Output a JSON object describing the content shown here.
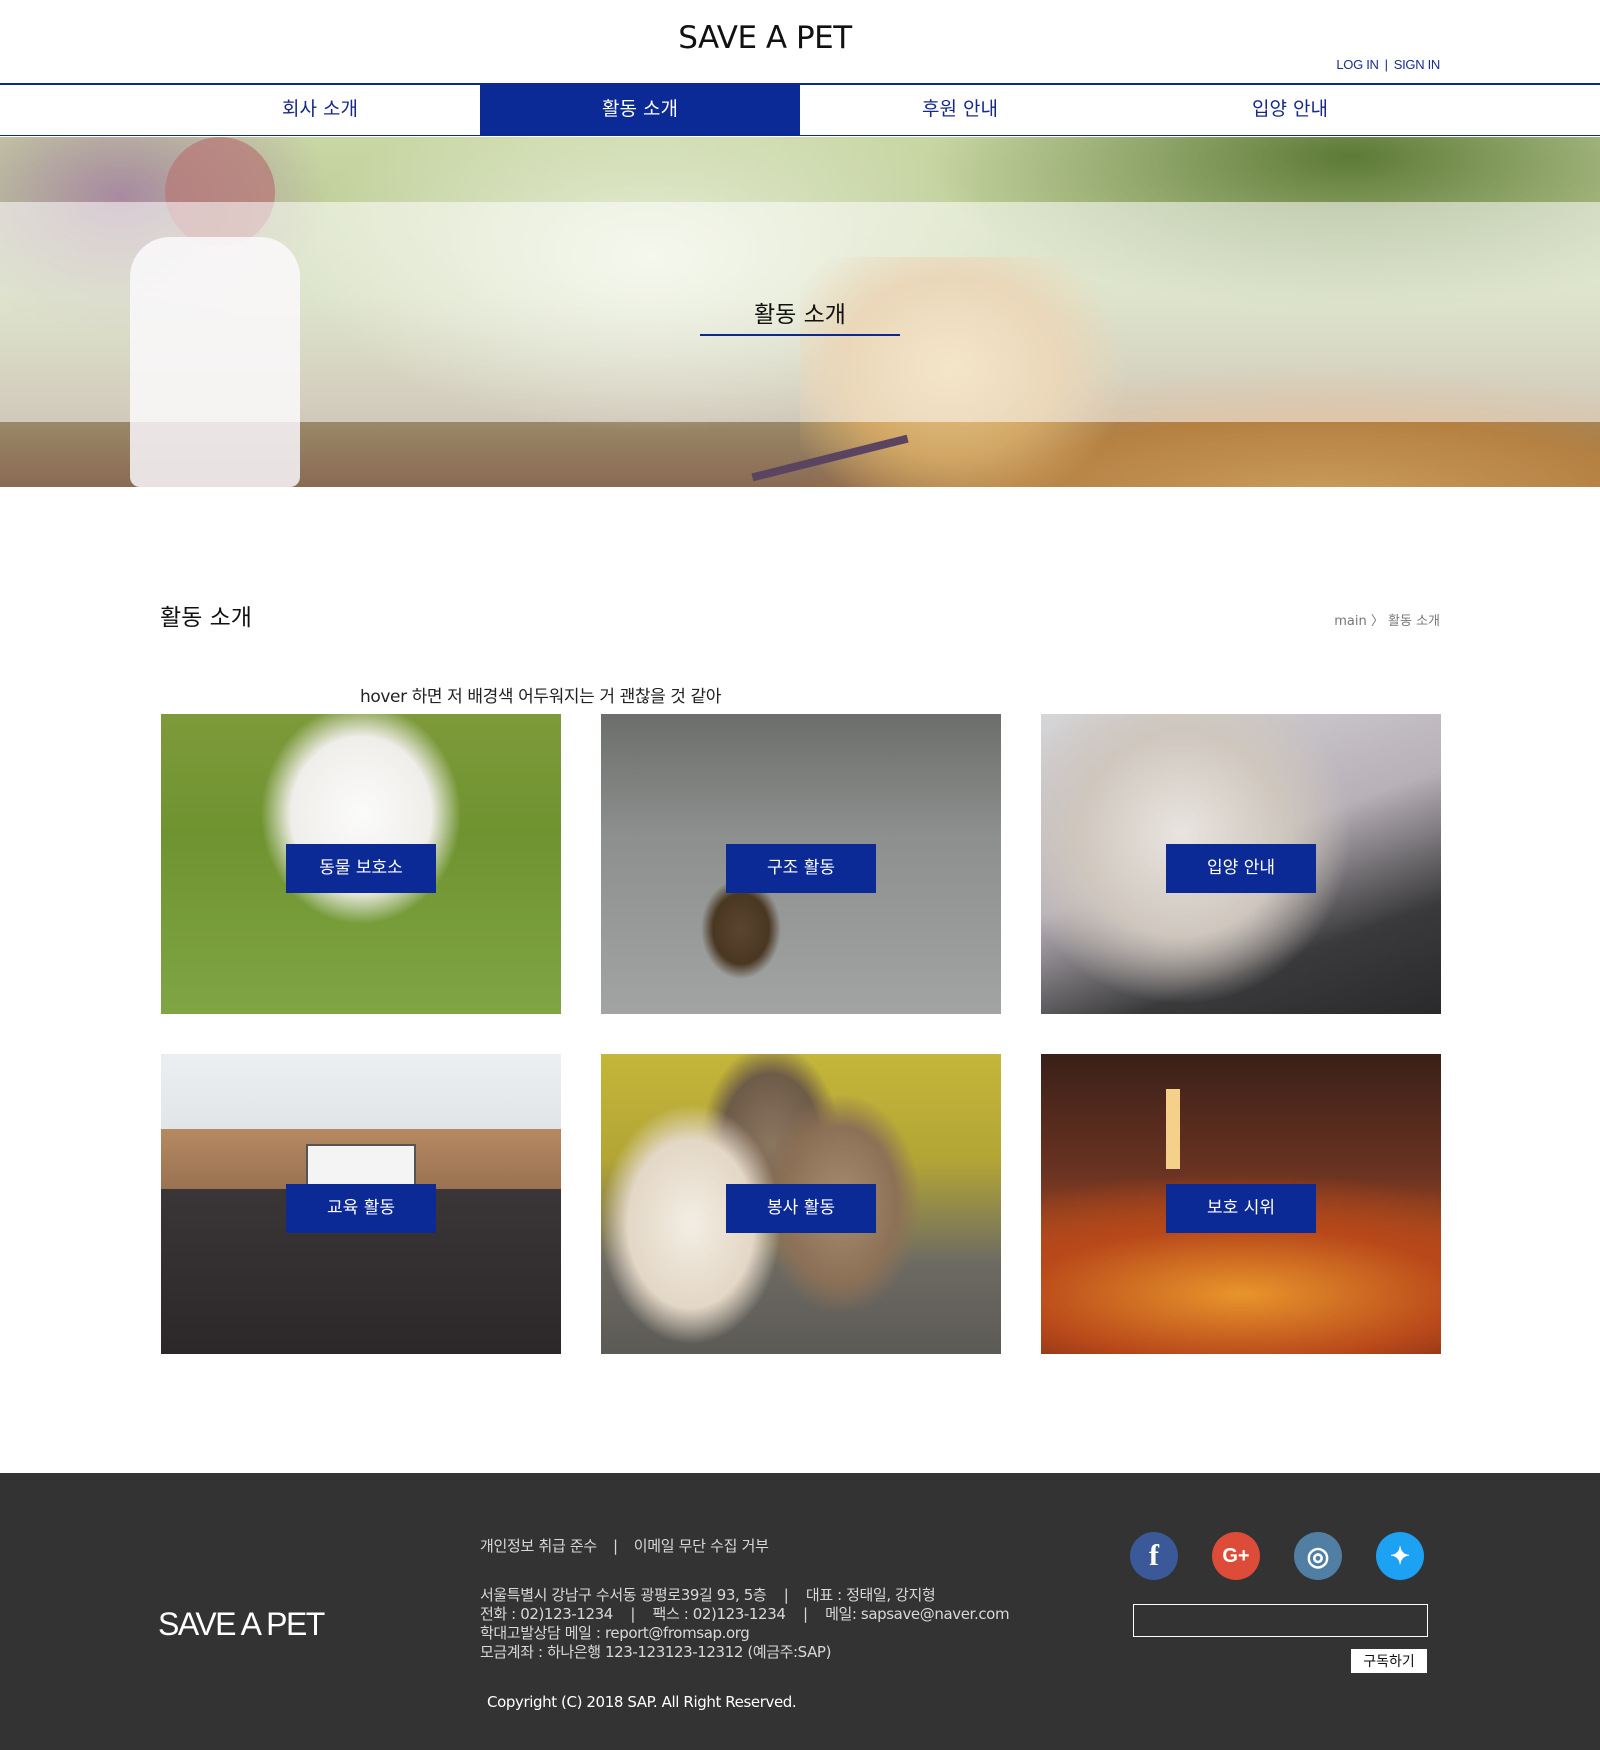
{
  "header": {
    "logo": "SAVE A PET",
    "login": "LOG IN",
    "auth_separator": "|",
    "signin": "SIGN IN"
  },
  "nav": {
    "items": [
      {
        "label": "회사 소개"
      },
      {
        "label": "활동 소개",
        "active": true
      },
      {
        "label": "후원 안내"
      },
      {
        "label": "입양 안내"
      }
    ]
  },
  "hero": {
    "title": "활동 소개"
  },
  "section": {
    "title": "활동 소개",
    "breadcrumb_home": "main",
    "breadcrumb_sep": "〉",
    "breadcrumb_current": "활동 소개",
    "note": "hover 하면 저 배경색 어두워지는 거 괜찮을 것 같아"
  },
  "cards": [
    {
      "label": "동물 보호소"
    },
    {
      "label": "구조 활동"
    },
    {
      "label": "입양 안내"
    },
    {
      "label": "교육 활동"
    },
    {
      "label": "봉사 활동"
    },
    {
      "label": "보호 시위"
    }
  ],
  "footer": {
    "logo": "SAVE A PET",
    "links": [
      "개인정보 취급 준수",
      "이메일 무단 수집 거부"
    ],
    "link_separator": "|",
    "info_lines": [
      "서울특별시 강남구 수서동 광평로39길 93, 5층    |    대표 : 정태일, 강지형",
      "전화 : 02)123-1234    |    팩스 : 02)123-1234    |    메일: sapsave@naver.com",
      "학대고발상담 메일 : report@fromsap.org",
      "모금계좌 : 하나은행 123-123123-12312 (예금주:SAP)"
    ],
    "copyright": "Copyright (C) 2018 SAP. All Right Reserved.",
    "social": [
      {
        "icon": "facebook-icon",
        "glyph": "f",
        "color": "#3b5998"
      },
      {
        "icon": "google-plus-icon",
        "glyph": "G+",
        "color": "#dd4b39"
      },
      {
        "icon": "instagram-icon",
        "glyph": "◎",
        "color": "#517fa4"
      },
      {
        "icon": "twitter-icon",
        "glyph": "✦",
        "color": "#1da1f2"
      }
    ],
    "subscribe_value": "",
    "subscribe_button": "구독하기"
  },
  "colors": {
    "brand": "#0c2a96",
    "footer_bg": "#333333"
  }
}
